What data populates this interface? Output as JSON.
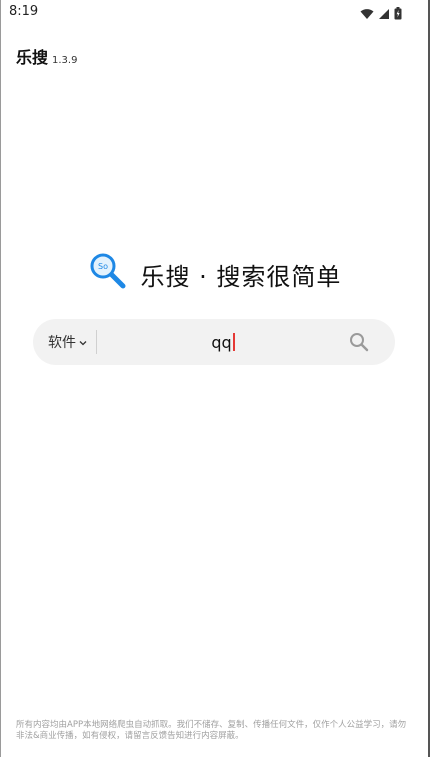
{
  "status_bar": {
    "time": "8:19",
    "icons": [
      "wifi-icon",
      "signal-icon",
      "battery-icon"
    ]
  },
  "app": {
    "name": "乐搜",
    "version": "1.3.9"
  },
  "hero": {
    "logo_icon": "magnifier-logo-icon",
    "logo_text": "So",
    "slogan": "乐搜 · 搜索很简单"
  },
  "search": {
    "category": "软件",
    "query": "qq",
    "search_icon": "search-icon"
  },
  "footer": {
    "disclaimer": "所有内容均由APP本地网络爬虫自动抓取。我们不储存、复制、传播任何文件，仅作个人公益学习，请勿非法&商业传播，如有侵权，请留言反馈告知进行内容屏蔽。"
  },
  "colors": {
    "background": "#ffffff",
    "search_bg": "#f2f2f2",
    "caret": "#e53935",
    "logo_blue": "#1e88e5"
  }
}
